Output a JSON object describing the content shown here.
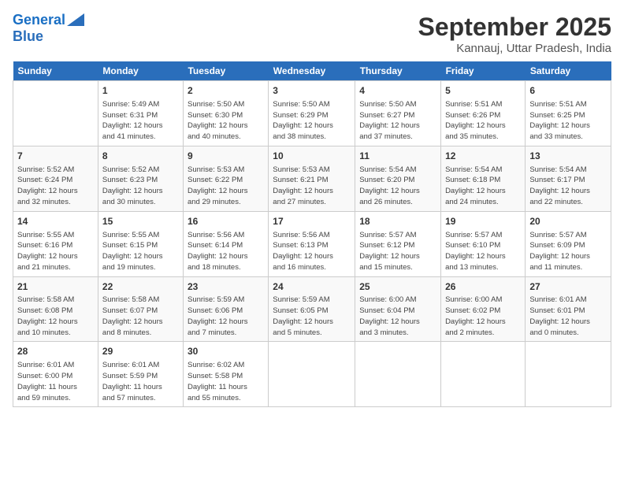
{
  "header": {
    "logo_line1": "General",
    "logo_line2": "Blue",
    "month_title": "September 2025",
    "subtitle": "Kannauj, Uttar Pradesh, India"
  },
  "days_of_week": [
    "Sunday",
    "Monday",
    "Tuesday",
    "Wednesday",
    "Thursday",
    "Friday",
    "Saturday"
  ],
  "weeks": [
    [
      {
        "num": "",
        "info": ""
      },
      {
        "num": "1",
        "info": "Sunrise: 5:49 AM\nSunset: 6:31 PM\nDaylight: 12 hours\nand 41 minutes."
      },
      {
        "num": "2",
        "info": "Sunrise: 5:50 AM\nSunset: 6:30 PM\nDaylight: 12 hours\nand 40 minutes."
      },
      {
        "num": "3",
        "info": "Sunrise: 5:50 AM\nSunset: 6:29 PM\nDaylight: 12 hours\nand 38 minutes."
      },
      {
        "num": "4",
        "info": "Sunrise: 5:50 AM\nSunset: 6:27 PM\nDaylight: 12 hours\nand 37 minutes."
      },
      {
        "num": "5",
        "info": "Sunrise: 5:51 AM\nSunset: 6:26 PM\nDaylight: 12 hours\nand 35 minutes."
      },
      {
        "num": "6",
        "info": "Sunrise: 5:51 AM\nSunset: 6:25 PM\nDaylight: 12 hours\nand 33 minutes."
      }
    ],
    [
      {
        "num": "7",
        "info": "Sunrise: 5:52 AM\nSunset: 6:24 PM\nDaylight: 12 hours\nand 32 minutes."
      },
      {
        "num": "8",
        "info": "Sunrise: 5:52 AM\nSunset: 6:23 PM\nDaylight: 12 hours\nand 30 minutes."
      },
      {
        "num": "9",
        "info": "Sunrise: 5:53 AM\nSunset: 6:22 PM\nDaylight: 12 hours\nand 29 minutes."
      },
      {
        "num": "10",
        "info": "Sunrise: 5:53 AM\nSunset: 6:21 PM\nDaylight: 12 hours\nand 27 minutes."
      },
      {
        "num": "11",
        "info": "Sunrise: 5:54 AM\nSunset: 6:20 PM\nDaylight: 12 hours\nand 26 minutes."
      },
      {
        "num": "12",
        "info": "Sunrise: 5:54 AM\nSunset: 6:18 PM\nDaylight: 12 hours\nand 24 minutes."
      },
      {
        "num": "13",
        "info": "Sunrise: 5:54 AM\nSunset: 6:17 PM\nDaylight: 12 hours\nand 22 minutes."
      }
    ],
    [
      {
        "num": "14",
        "info": "Sunrise: 5:55 AM\nSunset: 6:16 PM\nDaylight: 12 hours\nand 21 minutes."
      },
      {
        "num": "15",
        "info": "Sunrise: 5:55 AM\nSunset: 6:15 PM\nDaylight: 12 hours\nand 19 minutes."
      },
      {
        "num": "16",
        "info": "Sunrise: 5:56 AM\nSunset: 6:14 PM\nDaylight: 12 hours\nand 18 minutes."
      },
      {
        "num": "17",
        "info": "Sunrise: 5:56 AM\nSunset: 6:13 PM\nDaylight: 12 hours\nand 16 minutes."
      },
      {
        "num": "18",
        "info": "Sunrise: 5:57 AM\nSunset: 6:12 PM\nDaylight: 12 hours\nand 15 minutes."
      },
      {
        "num": "19",
        "info": "Sunrise: 5:57 AM\nSunset: 6:10 PM\nDaylight: 12 hours\nand 13 minutes."
      },
      {
        "num": "20",
        "info": "Sunrise: 5:57 AM\nSunset: 6:09 PM\nDaylight: 12 hours\nand 11 minutes."
      }
    ],
    [
      {
        "num": "21",
        "info": "Sunrise: 5:58 AM\nSunset: 6:08 PM\nDaylight: 12 hours\nand 10 minutes."
      },
      {
        "num": "22",
        "info": "Sunrise: 5:58 AM\nSunset: 6:07 PM\nDaylight: 12 hours\nand 8 minutes."
      },
      {
        "num": "23",
        "info": "Sunrise: 5:59 AM\nSunset: 6:06 PM\nDaylight: 12 hours\nand 7 minutes."
      },
      {
        "num": "24",
        "info": "Sunrise: 5:59 AM\nSunset: 6:05 PM\nDaylight: 12 hours\nand 5 minutes."
      },
      {
        "num": "25",
        "info": "Sunrise: 6:00 AM\nSunset: 6:04 PM\nDaylight: 12 hours\nand 3 minutes."
      },
      {
        "num": "26",
        "info": "Sunrise: 6:00 AM\nSunset: 6:02 PM\nDaylight: 12 hours\nand 2 minutes."
      },
      {
        "num": "27",
        "info": "Sunrise: 6:01 AM\nSunset: 6:01 PM\nDaylight: 12 hours\nand 0 minutes."
      }
    ],
    [
      {
        "num": "28",
        "info": "Sunrise: 6:01 AM\nSunset: 6:00 PM\nDaylight: 11 hours\nand 59 minutes."
      },
      {
        "num": "29",
        "info": "Sunrise: 6:01 AM\nSunset: 5:59 PM\nDaylight: 11 hours\nand 57 minutes."
      },
      {
        "num": "30",
        "info": "Sunrise: 6:02 AM\nSunset: 5:58 PM\nDaylight: 11 hours\nand 55 minutes."
      },
      {
        "num": "",
        "info": ""
      },
      {
        "num": "",
        "info": ""
      },
      {
        "num": "",
        "info": ""
      },
      {
        "num": "",
        "info": ""
      }
    ]
  ]
}
